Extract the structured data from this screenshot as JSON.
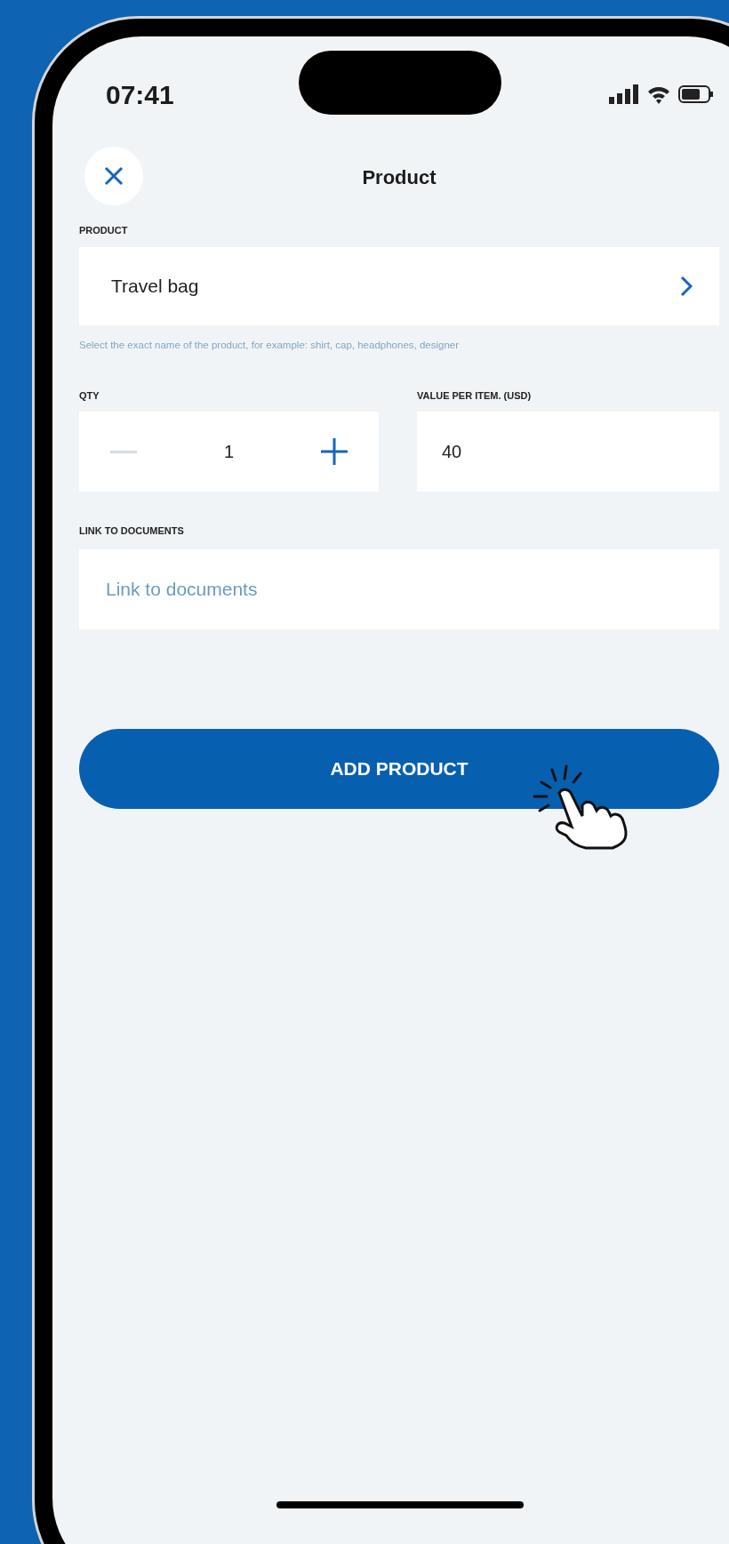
{
  "status_bar": {
    "time": "07:41"
  },
  "header": {
    "title": "Product"
  },
  "product": {
    "label": "PRODUCT",
    "value": "Travel bag",
    "hint": "Select the exact name of the product, for example: shirt, cap, headphones, designer"
  },
  "quantity": {
    "label": "QTY",
    "value": "1",
    "decrement_disabled": true
  },
  "value_per_item": {
    "label": "VALUE PER ITEM. (USD)",
    "value": "40"
  },
  "documents_link": {
    "label": "LINK TO DOCUMENTS",
    "placeholder": "Link to documents"
  },
  "buttons": [
    {
      "label": "ADD PRODUCT"
    }
  ]
}
